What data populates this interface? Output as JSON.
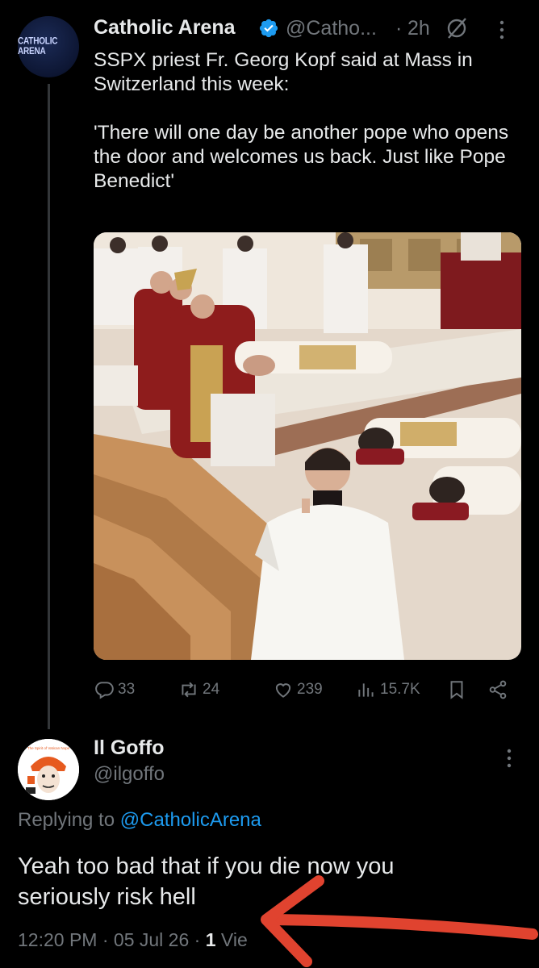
{
  "tweet": {
    "avatar_text": "CATHOLIC ARENA",
    "name": "Catholic Arena",
    "handle": "@Catho...",
    "separator": "·",
    "time": "2h",
    "text": "SSPX priest Fr. Georg Kopf said at Mass in Switzerland this week:\n\n'There will one day be another pope who opens the door and welcomes us back. Just like Pope Benedict'",
    "stats": {
      "replies": "33",
      "reposts": "24",
      "likes": "239",
      "views": "15.7K"
    },
    "icons": [
      "verified-icon",
      "grok-icon",
      "more-icon",
      "reply-icon",
      "repost-icon",
      "like-icon",
      "views-icon",
      "bookmark-icon",
      "share-icon"
    ]
  },
  "reply": {
    "name": "Il Goffo",
    "handle": "@ilgoffo",
    "avatar_caption": "The Spirit of Vatican Nope",
    "replying_prefix": "Replying to ",
    "replying_to": "@CatholicArena",
    "text": "Yeah too bad that if you die now you\nseriously risk hell",
    "time": "12:20 PM",
    "sep1": "·",
    "date": "05 Jul 26",
    "sep2": "·",
    "views_count": "1",
    "views_label": "Vie"
  },
  "colors": {
    "background": "#000000",
    "text": "#e7e9ea",
    "muted": "#71767b",
    "accent": "#1d9bf0",
    "annotation_arrow": "#e0432f",
    "vestment_red": "#8e1c1c"
  }
}
